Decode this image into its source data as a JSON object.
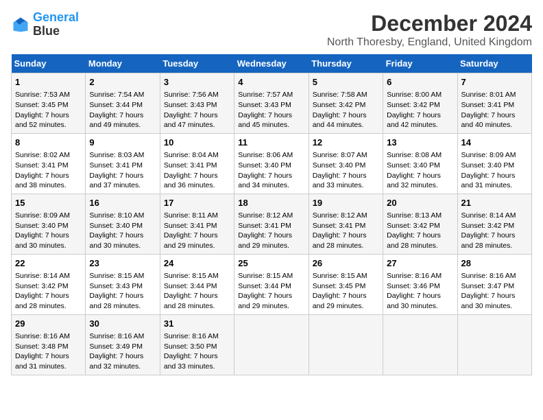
{
  "header": {
    "logo_line1": "General",
    "logo_line2": "Blue",
    "title": "December 2024",
    "subtitle": "North Thoresby, England, United Kingdom"
  },
  "days_of_week": [
    "Sunday",
    "Monday",
    "Tuesday",
    "Wednesday",
    "Thursday",
    "Friday",
    "Saturday"
  ],
  "weeks": [
    [
      {
        "day": "1",
        "rise": "Sunrise: 7:53 AM",
        "set": "Sunset: 3:45 PM",
        "daylight": "Daylight: 7 hours and 52 minutes."
      },
      {
        "day": "2",
        "rise": "Sunrise: 7:54 AM",
        "set": "Sunset: 3:44 PM",
        "daylight": "Daylight: 7 hours and 49 minutes."
      },
      {
        "day": "3",
        "rise": "Sunrise: 7:56 AM",
        "set": "Sunset: 3:43 PM",
        "daylight": "Daylight: 7 hours and 47 minutes."
      },
      {
        "day": "4",
        "rise": "Sunrise: 7:57 AM",
        "set": "Sunset: 3:43 PM",
        "daylight": "Daylight: 7 hours and 45 minutes."
      },
      {
        "day": "5",
        "rise": "Sunrise: 7:58 AM",
        "set": "Sunset: 3:42 PM",
        "daylight": "Daylight: 7 hours and 44 minutes."
      },
      {
        "day": "6",
        "rise": "Sunrise: 8:00 AM",
        "set": "Sunset: 3:42 PM",
        "daylight": "Daylight: 7 hours and 42 minutes."
      },
      {
        "day": "7",
        "rise": "Sunrise: 8:01 AM",
        "set": "Sunset: 3:41 PM",
        "daylight": "Daylight: 7 hours and 40 minutes."
      }
    ],
    [
      {
        "day": "8",
        "rise": "Sunrise: 8:02 AM",
        "set": "Sunset: 3:41 PM",
        "daylight": "Daylight: 7 hours and 38 minutes."
      },
      {
        "day": "9",
        "rise": "Sunrise: 8:03 AM",
        "set": "Sunset: 3:41 PM",
        "daylight": "Daylight: 7 hours and 37 minutes."
      },
      {
        "day": "10",
        "rise": "Sunrise: 8:04 AM",
        "set": "Sunset: 3:41 PM",
        "daylight": "Daylight: 7 hours and 36 minutes."
      },
      {
        "day": "11",
        "rise": "Sunrise: 8:06 AM",
        "set": "Sunset: 3:40 PM",
        "daylight": "Daylight: 7 hours and 34 minutes."
      },
      {
        "day": "12",
        "rise": "Sunrise: 8:07 AM",
        "set": "Sunset: 3:40 PM",
        "daylight": "Daylight: 7 hours and 33 minutes."
      },
      {
        "day": "13",
        "rise": "Sunrise: 8:08 AM",
        "set": "Sunset: 3:40 PM",
        "daylight": "Daylight: 7 hours and 32 minutes."
      },
      {
        "day": "14",
        "rise": "Sunrise: 8:09 AM",
        "set": "Sunset: 3:40 PM",
        "daylight": "Daylight: 7 hours and 31 minutes."
      }
    ],
    [
      {
        "day": "15",
        "rise": "Sunrise: 8:09 AM",
        "set": "Sunset: 3:40 PM",
        "daylight": "Daylight: 7 hours and 30 minutes."
      },
      {
        "day": "16",
        "rise": "Sunrise: 8:10 AM",
        "set": "Sunset: 3:40 PM",
        "daylight": "Daylight: 7 hours and 30 minutes."
      },
      {
        "day": "17",
        "rise": "Sunrise: 8:11 AM",
        "set": "Sunset: 3:41 PM",
        "daylight": "Daylight: 7 hours and 29 minutes."
      },
      {
        "day": "18",
        "rise": "Sunrise: 8:12 AM",
        "set": "Sunset: 3:41 PM",
        "daylight": "Daylight: 7 hours and 29 minutes."
      },
      {
        "day": "19",
        "rise": "Sunrise: 8:12 AM",
        "set": "Sunset: 3:41 PM",
        "daylight": "Daylight: 7 hours and 28 minutes."
      },
      {
        "day": "20",
        "rise": "Sunrise: 8:13 AM",
        "set": "Sunset: 3:42 PM",
        "daylight": "Daylight: 7 hours and 28 minutes."
      },
      {
        "day": "21",
        "rise": "Sunrise: 8:14 AM",
        "set": "Sunset: 3:42 PM",
        "daylight": "Daylight: 7 hours and 28 minutes."
      }
    ],
    [
      {
        "day": "22",
        "rise": "Sunrise: 8:14 AM",
        "set": "Sunset: 3:42 PM",
        "daylight": "Daylight: 7 hours and 28 minutes."
      },
      {
        "day": "23",
        "rise": "Sunrise: 8:15 AM",
        "set": "Sunset: 3:43 PM",
        "daylight": "Daylight: 7 hours and 28 minutes."
      },
      {
        "day": "24",
        "rise": "Sunrise: 8:15 AM",
        "set": "Sunset: 3:44 PM",
        "daylight": "Daylight: 7 hours and 28 minutes."
      },
      {
        "day": "25",
        "rise": "Sunrise: 8:15 AM",
        "set": "Sunset: 3:44 PM",
        "daylight": "Daylight: 7 hours and 29 minutes."
      },
      {
        "day": "26",
        "rise": "Sunrise: 8:15 AM",
        "set": "Sunset: 3:45 PM",
        "daylight": "Daylight: 7 hours and 29 minutes."
      },
      {
        "day": "27",
        "rise": "Sunrise: 8:16 AM",
        "set": "Sunset: 3:46 PM",
        "daylight": "Daylight: 7 hours and 30 minutes."
      },
      {
        "day": "28",
        "rise": "Sunrise: 8:16 AM",
        "set": "Sunset: 3:47 PM",
        "daylight": "Daylight: 7 hours and 30 minutes."
      }
    ],
    [
      {
        "day": "29",
        "rise": "Sunrise: 8:16 AM",
        "set": "Sunset: 3:48 PM",
        "daylight": "Daylight: 7 hours and 31 minutes."
      },
      {
        "day": "30",
        "rise": "Sunrise: 8:16 AM",
        "set": "Sunset: 3:49 PM",
        "daylight": "Daylight: 7 hours and 32 minutes."
      },
      {
        "day": "31",
        "rise": "Sunrise: 8:16 AM",
        "set": "Sunset: 3:50 PM",
        "daylight": "Daylight: 7 hours and 33 minutes."
      },
      null,
      null,
      null,
      null
    ]
  ]
}
